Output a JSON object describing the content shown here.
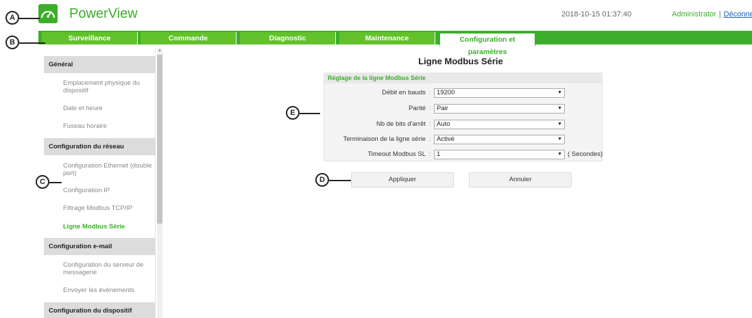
{
  "header": {
    "app_title": "PowerView",
    "datetime": "2018-10-15 01:37:40",
    "user": "Administrator",
    "separator": "|",
    "logout": "Déconnexion",
    "accent_color": "#3dae2b"
  },
  "tabs": [
    {
      "label": "Surveillance"
    },
    {
      "label": "Commande"
    },
    {
      "label": "Diagnostic"
    },
    {
      "label": "Maintenance"
    },
    {
      "label": "Configuration et paramètres",
      "active": true
    }
  ],
  "callouts": {
    "a": "A",
    "b": "B",
    "c": "C",
    "d": "D",
    "e": "E"
  },
  "sidebar": {
    "sections": [
      {
        "title": "Général",
        "items": [
          "Emplacement physique du dispositif",
          "Date et heure",
          "Fuseau horaire"
        ]
      },
      {
        "title": "Configuration du réseau",
        "items": [
          "Configuration Ethernet (double port)",
          "Configuration IP",
          "Filtrage Modbus TCP/IP",
          "Ligne Modbus Série"
        ]
      },
      {
        "title": "Configuration e-mail",
        "items": [
          "Configuration du serveur de messagerie",
          "Envoyer les événements"
        ]
      },
      {
        "title": "Configuration du dispositif",
        "items": []
      }
    ],
    "active_item": "Ligne Modbus Série"
  },
  "main": {
    "title": "Ligne Modbus Série",
    "panel_title": "Réglage de la ligne Modbus Série",
    "fields": [
      {
        "label": "Débit en bauds",
        "value": "19200"
      },
      {
        "label": "Parité",
        "value": "Pair"
      },
      {
        "label": "Nb de bits d'arrêt",
        "value": "Auto"
      },
      {
        "label": "Terminaison de la ligne série",
        "value": "Activé"
      },
      {
        "label": "Timeout Modbus SL",
        "value": "1",
        "unit": "( Secondes)"
      }
    ],
    "colon": ":",
    "apply_label": "Appliquer",
    "cancel_label": "Annuler"
  }
}
